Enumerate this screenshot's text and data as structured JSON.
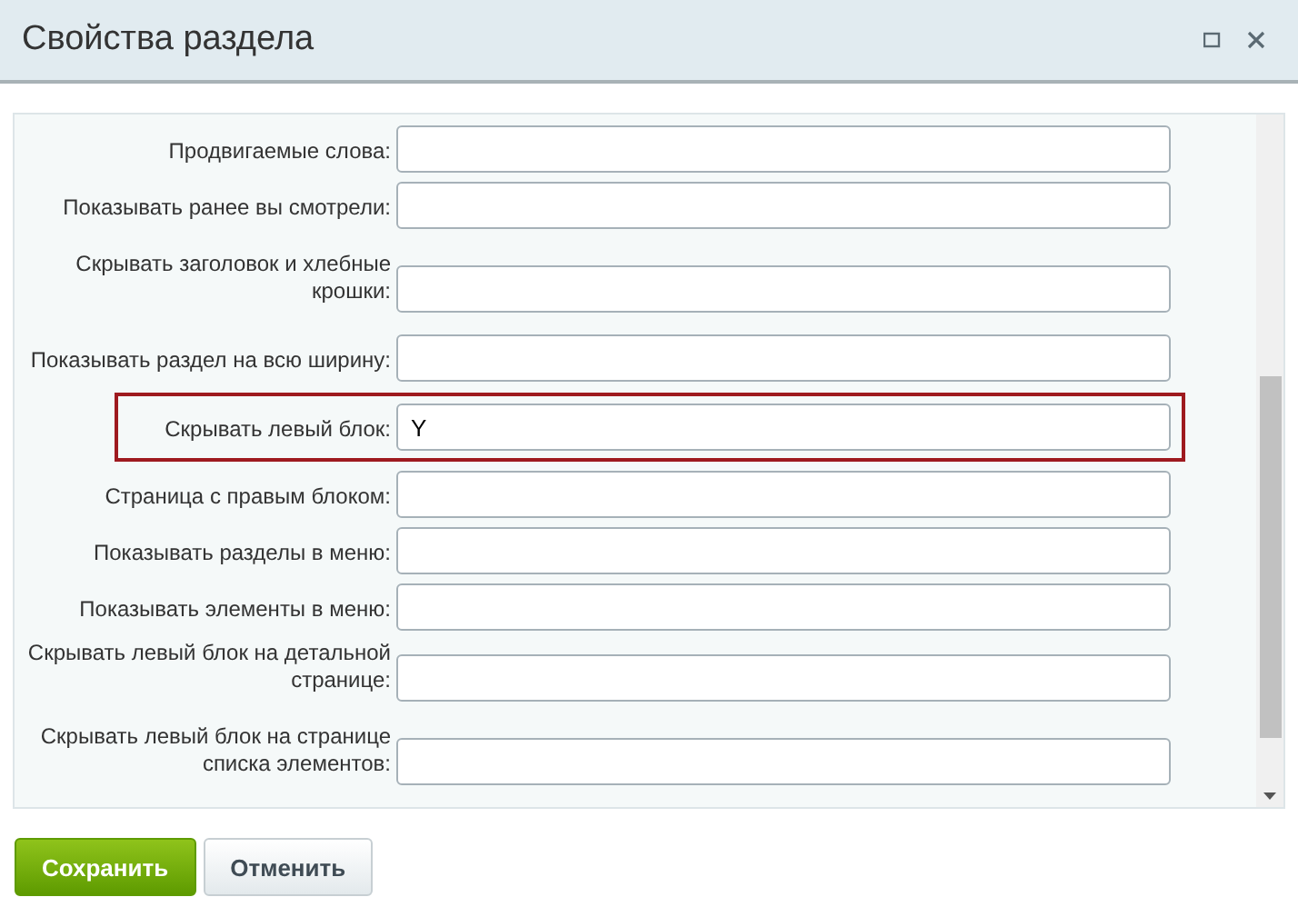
{
  "window": {
    "title": "Свойства раздела"
  },
  "fields": [
    {
      "label": "Продвигаемые слова:",
      "highlighted": false
    },
    {
      "label": "Показывать ранее вы смотрели:",
      "highlighted": false
    },
    {
      "label": "Скрывать заголовок и хлебные крошки:",
      "highlighted": false
    },
    {
      "label": "Показывать раздел на всю ширину:",
      "highlighted": false
    },
    {
      "label": "Скрывать левый блок:",
      "value": "Y",
      "highlighted": true
    },
    {
      "label": "Страница с правым блоком:",
      "highlighted": false
    },
    {
      "label": "Показывать разделы в меню:",
      "highlighted": false
    },
    {
      "label": "Показывать элементы в меню:",
      "highlighted": false
    },
    {
      "label": "Скрывать левый блок на детальной странице:",
      "highlighted": false
    },
    {
      "label": "Скрывать левый блок на странице списка элементов:",
      "highlighted": false
    }
  ],
  "buttons": [
    {
      "label": "Сохранить",
      "kind": "primary"
    },
    {
      "label": "Отменить",
      "kind": "secondary"
    }
  ]
}
